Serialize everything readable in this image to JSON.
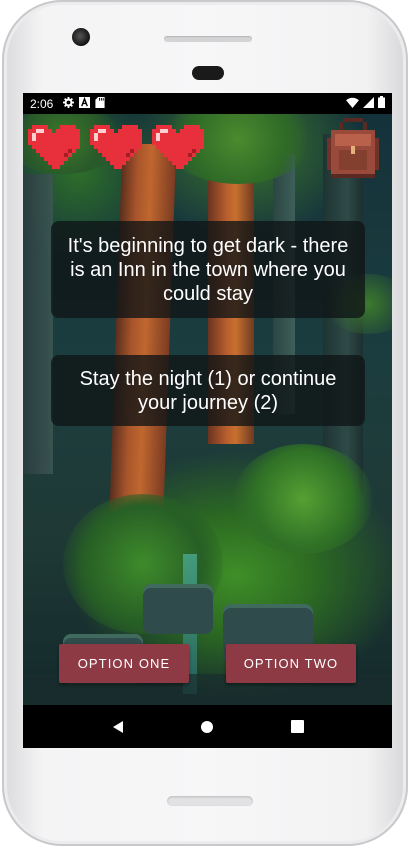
{
  "status_bar": {
    "time": "2:06",
    "left_icons": [
      "gear-icon",
      "a-icon",
      "sd-card-icon"
    ],
    "right_icons": [
      "wifi-icon",
      "signal-icon",
      "battery-icon"
    ]
  },
  "hud": {
    "lives": 3,
    "heart_color": "#e8303c",
    "inventory_icon": "backpack-icon"
  },
  "story": {
    "narration": "It's beginning to get dark - there is an Inn in the town where you could stay",
    "prompt": "Stay the night (1) or continue your journey (2)"
  },
  "options": {
    "option_one_label": "OPTION ONE",
    "option_two_label": "OPTION TWO",
    "button_color": "#8e3a45"
  },
  "nav_bar": {
    "buttons": [
      "back-icon",
      "home-icon",
      "recents-icon"
    ]
  }
}
